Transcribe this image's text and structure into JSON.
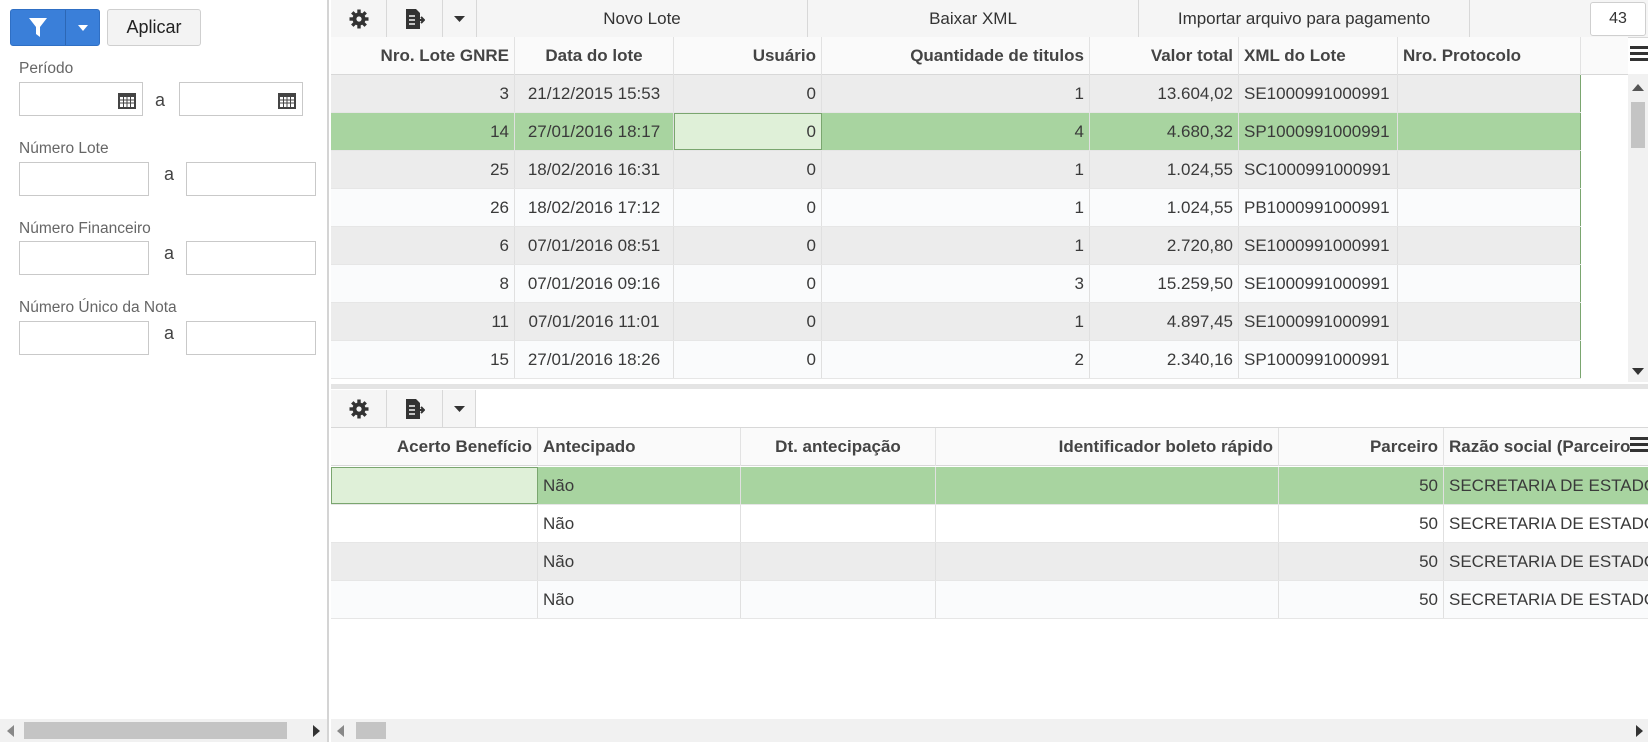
{
  "filter": {
    "apply_label": "Aplicar",
    "separator": "a",
    "fields": [
      {
        "label": "Período",
        "from_value": "",
        "to_value": ""
      },
      {
        "label": "Número Lote",
        "from_value": "",
        "to_value": ""
      },
      {
        "label": "Número Financeiro",
        "from_value": "",
        "to_value": ""
      },
      {
        "label": "Número Único da Nota",
        "from_value": "",
        "to_value": ""
      }
    ]
  },
  "top_toolbar": {
    "new_lot_label": "Novo Lote",
    "download_xml_label": "Baixar XML",
    "import_label": "Importar arquivo para pagamento",
    "record_count": "43"
  },
  "top_grid": {
    "headers": [
      "Nro. Lote GNRE",
      "Data do lote",
      "Usuário",
      "Quantidade de titulos",
      "Valor total",
      "XML do Lote",
      "Nro. Protocolo"
    ],
    "rows": [
      {
        "lote": "3",
        "data": "21/12/2015 15:53",
        "usuario": "0",
        "qtd": "1",
        "valor": "13.604,02",
        "xml": "SE1000991000991",
        "protocolo": ""
      },
      {
        "lote": "14",
        "data": "27/01/2016 18:17",
        "usuario": "0",
        "qtd": "4",
        "valor": "4.680,32",
        "xml": "SP1000991000991",
        "protocolo": ""
      },
      {
        "lote": "25",
        "data": "18/02/2016 16:31",
        "usuario": "0",
        "qtd": "1",
        "valor": "1.024,55",
        "xml": "SC1000991000991",
        "protocolo": ""
      },
      {
        "lote": "26",
        "data": "18/02/2016 17:12",
        "usuario": "0",
        "qtd": "1",
        "valor": "1.024,55",
        "xml": "PB1000991000991",
        "protocolo": ""
      },
      {
        "lote": "6",
        "data": "07/01/2016 08:51",
        "usuario": "0",
        "qtd": "1",
        "valor": "2.720,80",
        "xml": "SE1000991000991",
        "protocolo": ""
      },
      {
        "lote": "8",
        "data": "07/01/2016 09:16",
        "usuario": "0",
        "qtd": "3",
        "valor": "15.259,50",
        "xml": "SE1000991000991",
        "protocolo": ""
      },
      {
        "lote": "11",
        "data": "07/01/2016 11:01",
        "usuario": "0",
        "qtd": "1",
        "valor": "4.897,45",
        "xml": "SE1000991000991",
        "protocolo": ""
      },
      {
        "lote": "15",
        "data": "27/01/2016 18:26",
        "usuario": "0",
        "qtd": "2",
        "valor": "2.340,16",
        "xml": "SP1000991000991",
        "protocolo": ""
      }
    ]
  },
  "bottom_grid": {
    "headers": [
      "Acerto Benefício",
      "Antecipado",
      "Dt. antecipação",
      "Identificador boleto rápido",
      "Parceiro",
      "Razão social (Parceiro)"
    ],
    "rows": [
      {
        "acerto": "",
        "antecipado": "Não",
        "dt": "",
        "boleto": "",
        "parceiro": "50",
        "razao": "SECRETARIA DE ESTADO"
      },
      {
        "acerto": "",
        "antecipado": "Não",
        "dt": "",
        "boleto": "",
        "parceiro": "50",
        "razao": "SECRETARIA DE ESTADO"
      },
      {
        "acerto": "",
        "antecipado": "Não",
        "dt": "",
        "boleto": "",
        "parceiro": "50",
        "razao": "SECRETARIA DE ESTADO"
      },
      {
        "acerto": "",
        "antecipado": "Não",
        "dt": "",
        "boleto": "",
        "parceiro": "50",
        "razao": "SECRETARIA DE ESTADO"
      }
    ]
  },
  "icons": {
    "filter": "funnel-icon",
    "settings": "gear-icon",
    "export": "file-export-icon",
    "dropdown": "caret-down-icon",
    "calendar": "calendar-icon",
    "columns_menu": "hamburger-menu-icon"
  },
  "colors": {
    "primary": "#3a7fd9",
    "selected_row": "#a8d4a0",
    "focused_cell": "#dff0d8"
  }
}
